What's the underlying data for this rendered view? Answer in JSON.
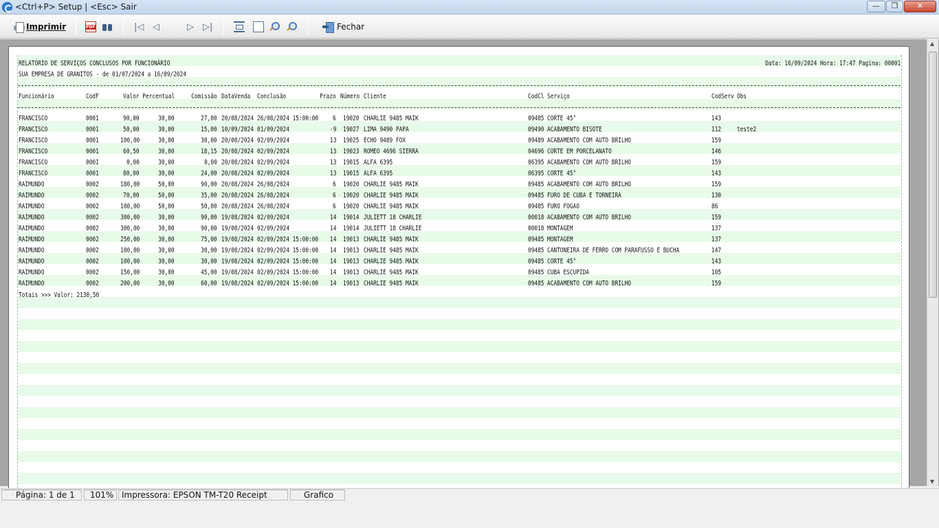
{
  "window": {
    "title": "<Ctrl+P> Setup | <Esc> Sair"
  },
  "toolbar": {
    "print_label": "Imprimir",
    "close_label": "Fechar"
  },
  "report": {
    "title": "RELATÓRIO DE SERVIÇOS CONCLUSOS POR FUNCIONÁRIO",
    "subtitle": "SUA EMPRESA DE GRANITOS - de 01/07/2024 a 16/09/2024",
    "meta": "Data: 16/09/2024 Hora: 17:47 Pagina: 00001",
    "headers": {
      "funcionario": "Funcionário",
      "codf": "CodF",
      "valor": "Valor",
      "percentual": "Percentual",
      "comissao": "Comissão",
      "datavenda": "DataVenda",
      "conclusao": "Conclusão",
      "prazo": "Prazo",
      "numero": "Número",
      "cliente": "Cliente",
      "codcl": "CodCl",
      "servico": "Serviço",
      "codserv": "CodServ",
      "obs": "Obs"
    },
    "rows": [
      {
        "funcionario": "FRANCISCO",
        "codf": "0001",
        "valor": "90,00",
        "percentual": "30,00",
        "comissao": "27,00",
        "datavenda": "20/08/2024",
        "conclusao": "26/08/2024 15:00:00",
        "prazo": "6",
        "numero": "19020",
        "cliente": "CHARLIE 9485 MAIK",
        "codcl": "09485",
        "servico": "CORTE 45°",
        "codserv": "143",
        "obs": ""
      },
      {
        "funcionario": "FRANCISCO",
        "codf": "0001",
        "valor": "50,00",
        "percentual": "30,00",
        "comissao": "15,00",
        "datavenda": "10/09/2024",
        "conclusao": "01/09/2024",
        "prazo": "-9",
        "numero": "19027",
        "cliente": "LIMA 9490 PAPA",
        "codcl": "09490",
        "servico": "ACABAMENTO BISOTE",
        "codserv": "112",
        "obs": "teste2"
      },
      {
        "funcionario": "FRANCISCO",
        "codf": "0001",
        "valor": "100,00",
        "percentual": "30,00",
        "comissao": "30,00",
        "datavenda": "20/08/2024",
        "conclusao": "02/09/2024",
        "prazo": "13",
        "numero": "19025",
        "cliente": "ECHO 9489 FOX",
        "codcl": "09489",
        "servico": "ACABAMENTO COM AUTO BRILHO",
        "codserv": "159",
        "obs": ""
      },
      {
        "funcionario": "FRANCISCO",
        "codf": "0001",
        "valor": "60,50",
        "percentual": "30,00",
        "comissao": "18,15",
        "datavenda": "20/08/2024",
        "conclusao": "02/09/2024",
        "prazo": "13",
        "numero": "19023",
        "cliente": "ROMEO 4696 SIERRA",
        "codcl": "04696",
        "servico": "CORTE EM PORCELANATO",
        "codserv": "146",
        "obs": ""
      },
      {
        "funcionario": "FRANCISCO",
        "codf": "0001",
        "valor": "0,00",
        "percentual": "30,00",
        "comissao": "0,00",
        "datavenda": "20/08/2024",
        "conclusao": "02/09/2024",
        "prazo": "13",
        "numero": "19015",
        "cliente": "ALFA 6395",
        "codcl": "06395",
        "servico": "ACABAMENTO COM AUTO BRILHO",
        "codserv": "159",
        "obs": ""
      },
      {
        "funcionario": "FRANCISCO",
        "codf": "0001",
        "valor": "80,00",
        "percentual": "30,00",
        "comissao": "24,00",
        "datavenda": "20/08/2024",
        "conclusao": "02/09/2024",
        "prazo": "13",
        "numero": "19015",
        "cliente": "ALFA 6395",
        "codcl": "06395",
        "servico": "CORTE 45°",
        "codserv": "143",
        "obs": ""
      },
      {
        "funcionario": "RAIMUNDO",
        "codf": "0002",
        "valor": "180,00",
        "percentual": "50,00",
        "comissao": "90,00",
        "datavenda": "20/08/2024",
        "conclusao": "26/08/2024",
        "prazo": "6",
        "numero": "19020",
        "cliente": "CHARLIE 9485 MAIK",
        "codcl": "09485",
        "servico": "ACABAMENTO COM AUTO BRILHO",
        "codserv": "159",
        "obs": ""
      },
      {
        "funcionario": "RAIMUNDO",
        "codf": "0002",
        "valor": "70,00",
        "percentual": "50,00",
        "comissao": "35,00",
        "datavenda": "20/08/2024",
        "conclusao": "26/08/2024",
        "prazo": "6",
        "numero": "19020",
        "cliente": "CHARLIE 9485 MAIK",
        "codcl": "09485",
        "servico": "FURO DE CUBA E TORNEIRA",
        "codserv": "130",
        "obs": ""
      },
      {
        "funcionario": "RAIMUNDO",
        "codf": "0002",
        "valor": "100,00",
        "percentual": "50,00",
        "comissao": "50,00",
        "datavenda": "20/08/2024",
        "conclusao": "26/08/2024",
        "prazo": "6",
        "numero": "19020",
        "cliente": "CHARLIE 9485 MAIK",
        "codcl": "09485",
        "servico": "FURO FOGAO",
        "codserv": "86",
        "obs": ""
      },
      {
        "funcionario": "RAIMUNDO",
        "codf": "0002",
        "valor": "300,00",
        "percentual": "30,00",
        "comissao": "90,00",
        "datavenda": "19/08/2024",
        "conclusao": "02/09/2024",
        "prazo": "14",
        "numero": "19014",
        "cliente": "JULIETT 18 CHARLIE",
        "codcl": "00018",
        "servico": "ACABAMENTO COM AUTO BRILHO",
        "codserv": "159",
        "obs": ""
      },
      {
        "funcionario": "RAIMUNDO",
        "codf": "0002",
        "valor": "300,00",
        "percentual": "30,00",
        "comissao": "90,00",
        "datavenda": "19/08/2024",
        "conclusao": "02/09/2024",
        "prazo": "14",
        "numero": "19014",
        "cliente": "JULIETT 18 CHARLIE",
        "codcl": "00018",
        "servico": "MONTAGEM",
        "codserv": "137",
        "obs": ""
      },
      {
        "funcionario": "RAIMUNDO",
        "codf": "0002",
        "valor": "250,00",
        "percentual": "30,00",
        "comissao": "75,00",
        "datavenda": "19/08/2024",
        "conclusao": "02/09/2024 15:00:00",
        "prazo": "14",
        "numero": "19013",
        "cliente": "CHARLIE 9485 MAIK",
        "codcl": "09485",
        "servico": "MONTAGEM",
        "codserv": "137",
        "obs": ""
      },
      {
        "funcionario": "RAIMUNDO",
        "codf": "0002",
        "valor": "100,00",
        "percentual": "30,00",
        "comissao": "30,00",
        "datavenda": "19/08/2024",
        "conclusao": "02/09/2024 15:00:00",
        "prazo": "14",
        "numero": "19013",
        "cliente": "CHARLIE 9485 MAIK",
        "codcl": "09485",
        "servico": "CANTONEIRA DE FERRO COM PARAFUSSO E BUCHA",
        "codserv": "147",
        "obs": ""
      },
      {
        "funcionario": "RAIMUNDO",
        "codf": "0002",
        "valor": "100,00",
        "percentual": "30,00",
        "comissao": "30,00",
        "datavenda": "19/08/2024",
        "conclusao": "02/09/2024 15:00:00",
        "prazo": "14",
        "numero": "19013",
        "cliente": "CHARLIE 9485 MAIK",
        "codcl": "09485",
        "servico": "CORTE 45°",
        "codserv": "143",
        "obs": ""
      },
      {
        "funcionario": "RAIMUNDO",
        "codf": "0002",
        "valor": "150,00",
        "percentual": "30,00",
        "comissao": "45,00",
        "datavenda": "19/08/2024",
        "conclusao": "02/09/2024 15:00:00",
        "prazo": "14",
        "numero": "19013",
        "cliente": "CHARLIE 9485 MAIK",
        "codcl": "09485",
        "servico": "CUBA ESCUPIDA",
        "codserv": "105",
        "obs": ""
      },
      {
        "funcionario": "RAIMUNDO",
        "codf": "0002",
        "valor": "200,00",
        "percentual": "30,00",
        "comissao": "60,00",
        "datavenda": "19/08/2024",
        "conclusao": "02/09/2024 15:00:00",
        "prazo": "14",
        "numero": "19013",
        "cliente": "CHARLIE 9485 MAIK",
        "codcl": "09485",
        "servico": "ACABAMENTO COM AUTO BRILHO",
        "codserv": "159",
        "obs": ""
      }
    ],
    "totals": "Totais >>> Valor: 2130,50"
  },
  "statusbar": {
    "page": "Página: 1 de 1",
    "zoom": "101%",
    "printer": "Impressora: EPSON TM-T20 Receipt",
    "mode": "Grafico"
  },
  "icons": {
    "app": "app-icon",
    "print": "printer-icon",
    "pdf": "pdf-icon",
    "find": "binoculars-icon",
    "first": "first-page-icon",
    "prev": "previous-page-icon",
    "next": "next-page-icon",
    "last": "last-page-icon",
    "fit_width": "fit-width-icon",
    "whole_page": "whole-page-icon",
    "zoom_in": "zoom-in-icon",
    "zoom_out": "zoom-out-icon",
    "close": "exit-icon"
  },
  "colors": {
    "band": "#e8fae8",
    "titlebar": "#c3d6ef",
    "close_button": "#c8462f"
  }
}
